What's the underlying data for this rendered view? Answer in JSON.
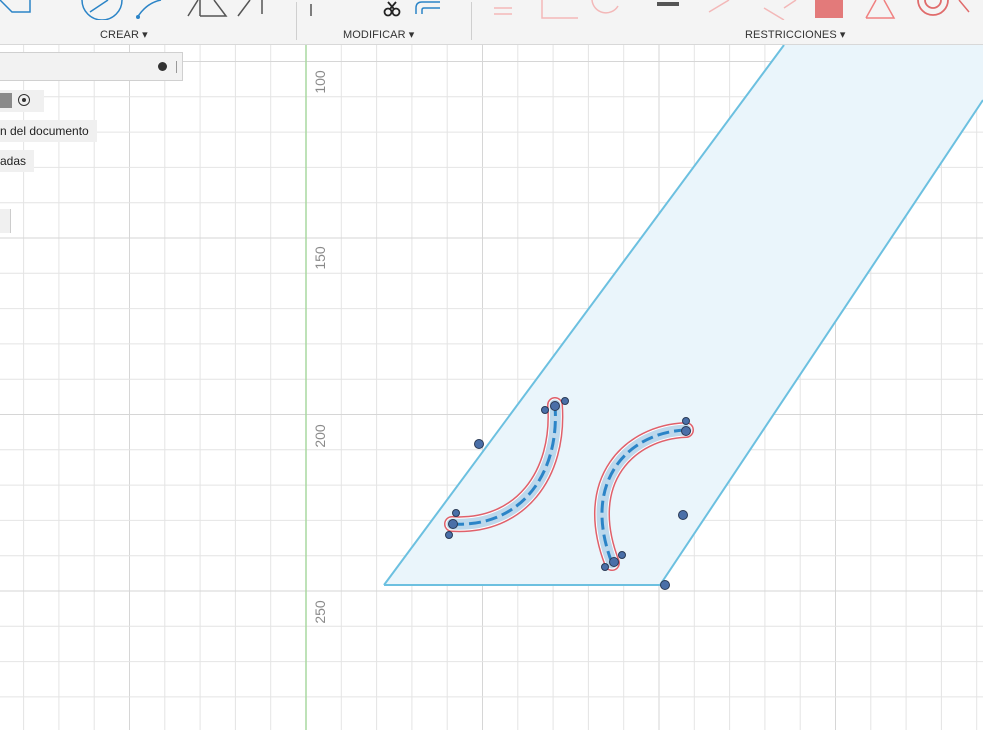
{
  "toolbar": {
    "groups": [
      {
        "label": "CREAR ▾"
      },
      {
        "label": "MODIFICAR ▾"
      },
      {
        "label": "RESTRICCIONES ▾"
      }
    ]
  },
  "browser": {
    "item_document_units": "n del documento",
    "item_named_views": "adas"
  },
  "ruler": {
    "labels": [
      "100",
      "150",
      "200",
      "250"
    ]
  },
  "colors": {
    "grid": "#e4e4e4",
    "axis_green": "#a9d8a0",
    "sketch_blue": "#6cc0e0",
    "profile_fill": "#eaf5fb",
    "constraint_red": "#e0606a",
    "point_blue": "#4a6fa8"
  }
}
